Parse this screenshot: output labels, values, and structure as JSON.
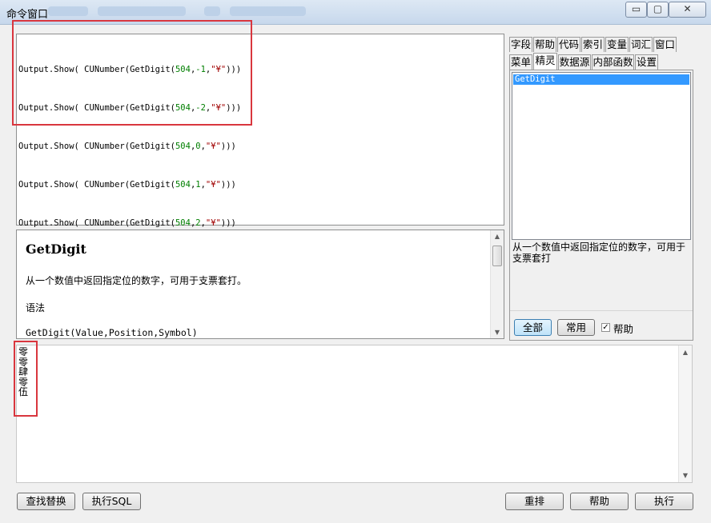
{
  "window": {
    "title": "命令窗口",
    "controls": {
      "minimize": "▭",
      "maximize": "▢",
      "close": "✕"
    }
  },
  "editor": {
    "lines": [
      {
        "prefix": "Output.Show( CUNumber(GetDigit(",
        "num1": "504",
        "sep": ",",
        "num2": "-1",
        "sep2": ",",
        "str": "\"¥\"",
        "suffix": ")))"
      },
      {
        "prefix": "Output.Show( CUNumber(GetDigit(",
        "num1": "504",
        "sep": ",",
        "num2": "-2",
        "sep2": ",",
        "str": "\"¥\"",
        "suffix": ")))"
      },
      {
        "prefix": "Output.Show( CUNumber(GetDigit(",
        "num1": "504",
        "sep": ",",
        "num2": "0",
        "sep2": ",",
        "str": "\"¥\"",
        "suffix": ")))"
      },
      {
        "prefix": "Output.Show( CUNumber(GetDigit(",
        "num1": "504",
        "sep": ",",
        "num2": "1",
        "sep2": ",",
        "str": "\"¥\"",
        "suffix": ")))"
      },
      {
        "prefix": "Output.Show( CUNumber(GetDigit(",
        "num1": "504",
        "sep": ",",
        "num2": "2",
        "sep2": ",",
        "str": "\"¥\"",
        "suffix": ")))"
      }
    ]
  },
  "help": {
    "title": "GetDigit",
    "description": "从一个数值中返回指定位的数字，可用于支票套打。",
    "syntax_label": "语法",
    "syntax": "GetDigit(Value,Position,Symbol)"
  },
  "output": {
    "lines": [
      "零",
      "零",
      "肆",
      "零",
      "伍"
    ]
  },
  "tabs_row1": [
    "字段",
    "帮助",
    "代码",
    "索引",
    "变量",
    "词汇",
    "窗口"
  ],
  "tabs_row2": [
    "菜单",
    "精灵",
    "数据源",
    "内部函数",
    "设置"
  ],
  "active_tab": "精灵",
  "wizard": {
    "items": [
      "GetDigit"
    ],
    "description": "从一个数值中返回指定位的数字，可用于支票套打",
    "btn_all": "全部",
    "btn_common": "常用",
    "checkbox_help": "帮助",
    "checkbox_checked": "✓"
  },
  "footer": {
    "find_replace": "查找替换",
    "exec_sql": "执行SQL",
    "rearrange": "重排",
    "help": "帮助",
    "execute": "执行"
  }
}
